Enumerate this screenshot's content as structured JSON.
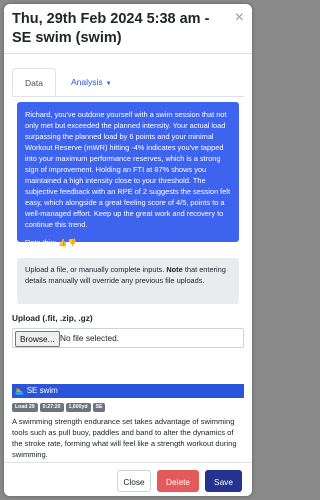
{
  "modal": {
    "title": "Thu, 29th Feb 2024 5:38 am - SE swim (swim)",
    "close_glyph": "×"
  },
  "tabs": [
    {
      "label": "Data"
    },
    {
      "label": "Analysis",
      "caret": "▼"
    }
  ],
  "analysis": {
    "text": "Richard, you've outdone yourself with a swim session that not only met but exceeded the planned intensity. Your actual load surpassing the planned load by 6 points and your minimal Workout Reserve (mWR) hitting -4% indicates you've tapped into your maximum performance reserves, which is a strong sign of improvement. Holding an FTI at 87% shows you maintained a high intensity close to your threshold. The subjective feedback with an RPE of 2 suggests the session felt easy, which alongside a great feeling score of 4/5, points to a well-managed effort. Keep up the great work and recovery to continue this trend.",
    "rate_label": "Rate this:",
    "thumbs_up": "👍",
    "thumbs_down": "👎",
    "background": "#3e64ef"
  },
  "upload_note": {
    "prefix": "Upload a file, or manually complete inputs. ",
    "bold": "Note",
    "suffix": " that entering details manually will override any previous file uploads."
  },
  "upload": {
    "label": "Upload (.fit, .zip, .gz)",
    "browse": "Browse...",
    "status": "No file selected."
  },
  "workout": {
    "icon": "🏊",
    "name": "SE swim",
    "badges": [
      "Load 29",
      "0:27:20",
      "1,600yd",
      "SE"
    ],
    "description": "A swimming strength endurance set takes advantage of swimming tools such as pull buoy, paddles and band to alter the dynamics of the stroke rate, forming what will feel like a strength workout during swimming."
  },
  "footer": {
    "close": "Close",
    "delete": "Delete",
    "save": "Save"
  },
  "colors": {
    "delete": "#e25a5a",
    "save": "#24338f",
    "tab_link": "#2d55d6",
    "workout_bar": "#2b55d9"
  }
}
